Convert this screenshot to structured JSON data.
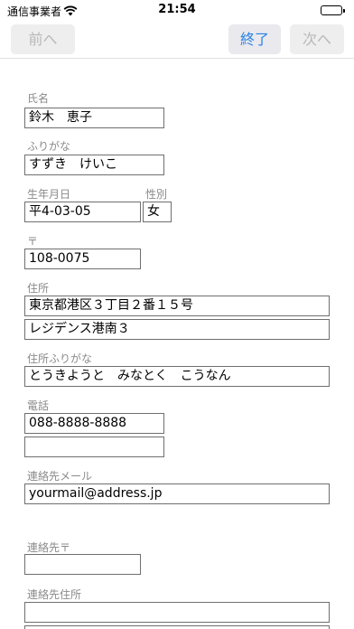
{
  "status_bar": {
    "carrier": "通信事業者",
    "time": "21:54"
  },
  "toolbar": {
    "prev_label": "前へ",
    "done_label": "終了",
    "next_label": "次へ"
  },
  "form": {
    "name_label": "氏名",
    "name_value": "鈴木　恵子",
    "furigana_label": "ふりがな",
    "furigana_value": "すずき　けいこ",
    "birthdate_label": "生年月日",
    "birthdate_value": "平4-03-05",
    "gender_label": "性別",
    "gender_value": "女",
    "postal_label": "〒",
    "postal_value": "108-0075",
    "address_label": "住所",
    "address_line1": "東京都港区３丁目２番１５号",
    "address_line2": "レジデンス港南３",
    "address_kana_label": "住所ふりがな",
    "address_kana_value": "とうきようと　みなとく　こうなん",
    "phone_label": "電話",
    "phone1_value": "088-8888-8888",
    "phone2_value": "",
    "contact_email_label": "連絡先メール",
    "contact_email_value": "yourmail@address.jp",
    "contact_postal_label": "連絡先〒",
    "contact_postal_value": "",
    "contact_address_label": "連絡先住所",
    "contact_address_value": ""
  }
}
